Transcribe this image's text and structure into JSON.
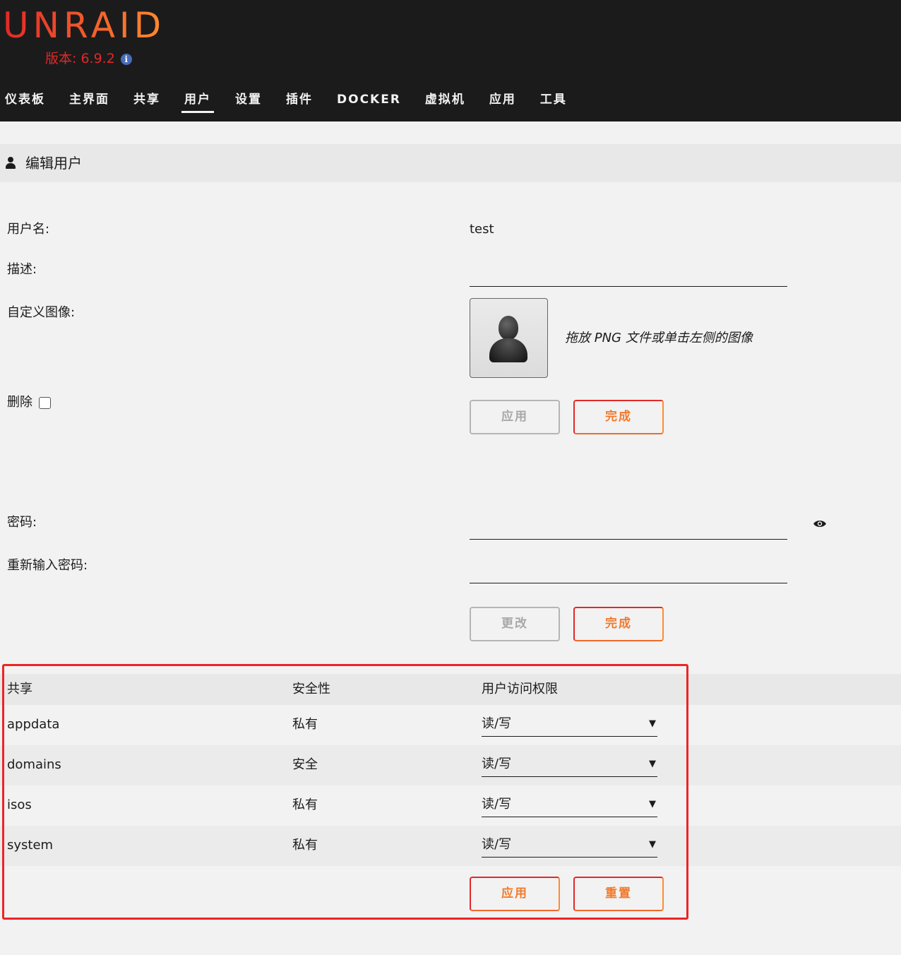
{
  "app": {
    "logo": "UNRAID",
    "version": "版本: 6.9.2"
  },
  "nav": [
    "仪表板",
    "主界面",
    "共享",
    "用户",
    "设置",
    "插件",
    "DOCKER",
    "虚拟机",
    "应用",
    "工具"
  ],
  "nav_active": "用户",
  "page_title": "编辑用户",
  "form": {
    "username_label": "用户名:",
    "username_value": "test",
    "description_label": "描述:",
    "description_value": "",
    "custom_image_label": "自定义图像:",
    "image_hint": "拖放 PNG 文件或单击左侧的图像",
    "delete_label": "删除",
    "apply_label": "应用",
    "done_label": "完成",
    "password_label": "密码:",
    "password_value": "",
    "retype_label": "重新输入密码:",
    "retype_value": "",
    "change_label": "更改",
    "done2_label": "完成"
  },
  "shares_table": {
    "headers": [
      "共享",
      "安全性",
      "用户访问权限"
    ],
    "rows": [
      {
        "share": "appdata",
        "security": "私有",
        "access": "读/写"
      },
      {
        "share": "domains",
        "security": "安全",
        "access": "读/写"
      },
      {
        "share": "isos",
        "security": "私有",
        "access": "读/写"
      },
      {
        "share": "system",
        "security": "私有",
        "access": "读/写"
      }
    ],
    "apply_label": "应用",
    "reset_label": "重置"
  },
  "icons": [
    "info-icon",
    "user-icon",
    "avatar-icon",
    "eye-icon",
    "dropdown-arrow-icon"
  ],
  "colors": {
    "accent_start": "#e22828",
    "accent_end": "#ff8c2f",
    "header_bg": "#1c1b1b",
    "highlight": "#ee2424"
  }
}
